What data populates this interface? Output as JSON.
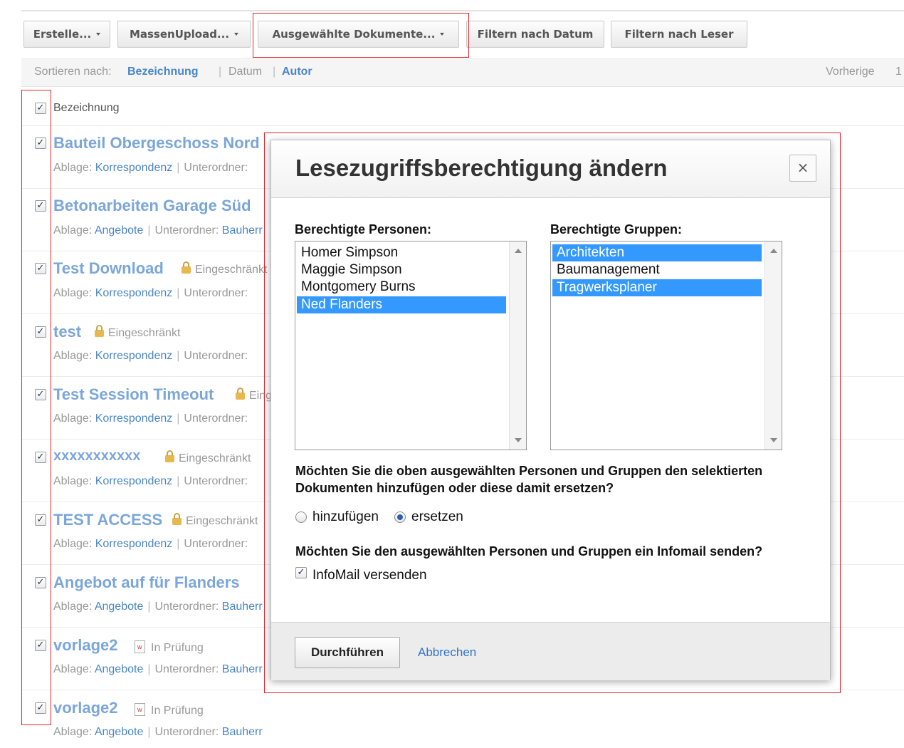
{
  "toolbar": {
    "create_label": "Erstelle...",
    "mass_upload_label": "MassenUpload...",
    "selected_docs_label": "Ausgewählte Dokumente...",
    "filter_date_label": "Filtern nach Datum",
    "filter_reader_label": "Filtern nach Leser"
  },
  "sortbar": {
    "label": "Sortieren nach:",
    "options": [
      "Bezeichnung",
      "Datum",
      "Autor"
    ],
    "pagination_prev": "Vorherige",
    "pagination_page": "1"
  },
  "list": {
    "header_label": "Bezeichnung",
    "items": [
      {
        "title": "Bauteil Obergeschoss Nord",
        "status": "",
        "ablage_label": "Ablage:",
        "ablage": "Korrespondenz",
        "unterordner_label": "Unterordner:",
        "unterordner": ""
      },
      {
        "title": "Betonarbeiten Garage Süd",
        "status": "",
        "ablage_label": "Ablage:",
        "ablage": "Angebote",
        "unterordner_label": "Unterordner:",
        "unterordner": "Bauherr"
      },
      {
        "title": "Test Download",
        "status": "Eingeschränkt",
        "ablage_label": "Ablage:",
        "ablage": "Korrespondenz",
        "unterordner_label": "Unterordner:",
        "unterordner": ""
      },
      {
        "title": "test",
        "status": "Eingeschränkt",
        "ablage_label": "Ablage:",
        "ablage": "Korrespondenz",
        "unterordner_label": "Unterordner:",
        "unterordner": ""
      },
      {
        "title": "Test Session Timeout",
        "status": "Eingeschränkt",
        "ablage_label": "Ablage:",
        "ablage": "Korrespondenz",
        "unterordner_label": "Unterordner:",
        "unterordner": ""
      },
      {
        "title": "xxxxxxxxxxx",
        "status": "Eingeschränkt",
        "ablage_label": "Ablage:",
        "ablage": "Korrespondenz",
        "unterordner_label": "Unterordner:",
        "unterordner": ""
      },
      {
        "title": "TEST ACCESS",
        "status": "Eingeschränkt",
        "ablage_label": "Ablage:",
        "ablage": "Korrespondenz",
        "unterordner_label": "Unterordner:",
        "unterordner": ""
      },
      {
        "title": "Angebot auf für Flanders",
        "status": "",
        "ablage_label": "Ablage:",
        "ablage": "Angebote",
        "unterordner_label": "Unterordner:",
        "unterordner": "Bauherr"
      },
      {
        "title": "vorlage2",
        "status": "In Prüfung",
        "ablage_label": "Ablage:",
        "ablage": "Angebote",
        "unterordner_label": "Unterordner:",
        "unterordner": "Bauherr"
      },
      {
        "title": "vorlage2",
        "status": "In Prüfung",
        "ablage_label": "Ablage:",
        "ablage": "Angebote",
        "unterordner_label": "Unterordner:",
        "unterordner": "Bauherr"
      }
    ]
  },
  "modal": {
    "title": "Lesezugriffsberechtigung ändern",
    "close_symbol": "×",
    "persons_label": "Berechtigte Personen:",
    "persons": [
      {
        "name": "Homer Simpson",
        "selected": false
      },
      {
        "name": "Maggie Simpson",
        "selected": false
      },
      {
        "name": "Montgomery Burns",
        "selected": false
      },
      {
        "name": "Ned Flanders",
        "selected": true
      }
    ],
    "groups_label": "Berechtigte Gruppen:",
    "groups": [
      {
        "name": "Architekten",
        "selected": true
      },
      {
        "name": "Baumanagement",
        "selected": false
      },
      {
        "name": "Tragwerksplaner",
        "selected": true
      }
    ],
    "question_mode_line1": "Möchten Sie die oben ausgewählten Personen und Gruppen den selektierten",
    "question_mode_line2": "Dokumenten hinzufügen oder diese damit ersetzen?",
    "option_add": "hinzufügen",
    "option_replace": "ersetzen",
    "selected_option": "ersetzen",
    "question_mail": "Möchten Sie den ausgewählten Personen und Gruppen ein Infomail senden?",
    "infomail_label": "InfoMail versenden",
    "infomail_checked": true,
    "submit_label": "Durchführen",
    "cancel_label": "Abbrechen"
  },
  "colors": {
    "link": "#4a86c5",
    "title_link": "#7ba6d9",
    "selection": "#3399ff",
    "highlight_box": "#e0262b"
  }
}
